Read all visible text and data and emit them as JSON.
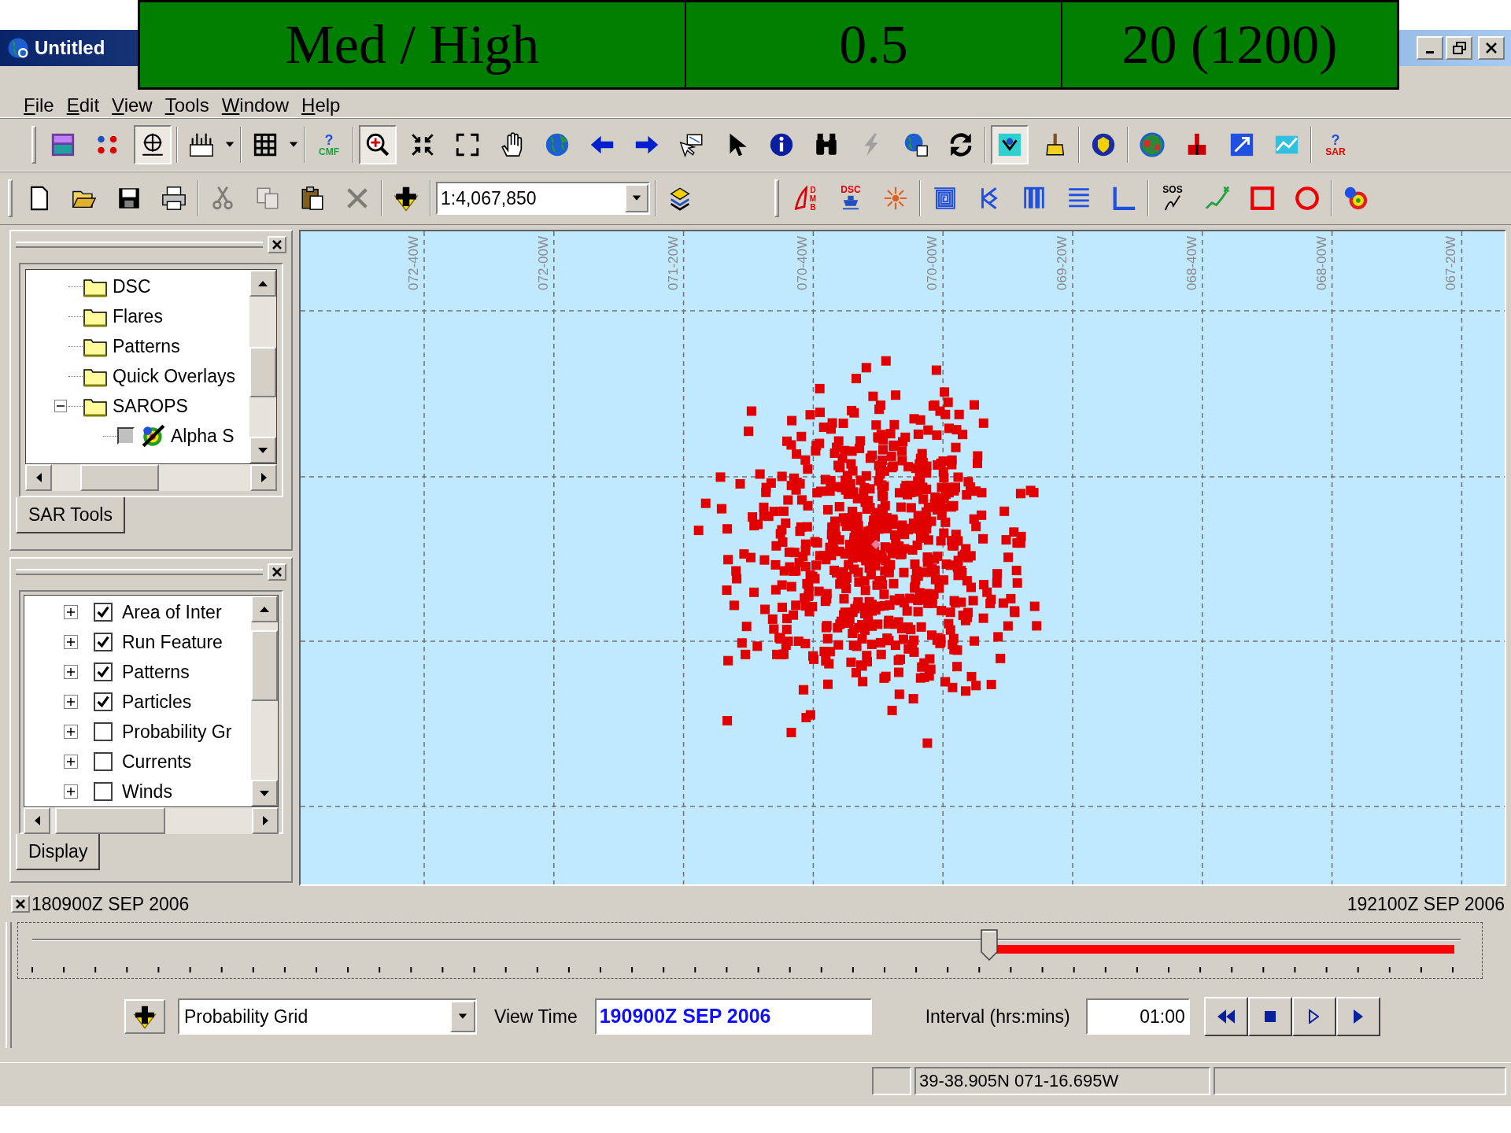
{
  "title_bar": {
    "title": "Untitled"
  },
  "banner": {
    "cells": [
      "Med / High",
      "0.5",
      "20 (1200)"
    ]
  },
  "menu": [
    "File",
    "Edit",
    "View",
    "Tools",
    "Window",
    "Help"
  ],
  "toolbar_1": [
    {
      "buttons": [
        {
          "kind": "logo",
          "selected": false
        },
        {
          "kind": "cluster",
          "selected": false
        },
        {
          "kind": "plate",
          "selected": true
        }
      ]
    },
    {
      "buttons": [
        {
          "kind": "ruler",
          "selected": false
        }
      ]
    },
    {
      "buttons": [
        {
          "kind": "grid",
          "selected": false
        }
      ]
    },
    {
      "buttons": [
        {
          "kind": "cmfhelp",
          "selected": false,
          "captions": [
            "?",
            "CMF"
          ]
        }
      ]
    },
    {
      "buttons": [
        {
          "kind": "zoom",
          "selected": true
        },
        {
          "kind": "collapse",
          "selected": false
        },
        {
          "kind": "expand",
          "selected": false
        },
        {
          "kind": "hand",
          "selected": false
        },
        {
          "kind": "globe",
          "selected": false
        },
        {
          "kind": "left",
          "selected": false
        },
        {
          "kind": "right",
          "selected": false
        },
        {
          "kind": "flag",
          "selected": false
        },
        {
          "kind": "pointer",
          "selected": false
        },
        {
          "kind": "info",
          "selected": false
        },
        {
          "kind": "binoculars",
          "selected": false
        },
        {
          "kind": "lightning",
          "selected": false
        },
        {
          "kind": "globelock",
          "selected": false
        },
        {
          "kind": "refresh",
          "selected": false
        }
      ]
    },
    {
      "buttons": [
        {
          "kind": "radar",
          "selected": true
        },
        {
          "kind": "brush",
          "selected": false
        }
      ]
    },
    {
      "buttons": [
        {
          "kind": "shield",
          "selected": false
        }
      ]
    },
    {
      "buttons": [
        {
          "kind": "earth",
          "selected": false
        },
        {
          "kind": "marker",
          "selected": false
        },
        {
          "kind": "bluebox",
          "selected": false
        },
        {
          "kind": "chart",
          "selected": false
        }
      ]
    },
    {
      "buttons": [
        {
          "kind": "sarhelp",
          "selected": false,
          "captions": [
            "?",
            "SAR"
          ]
        }
      ]
    }
  ],
  "toolbar_2": [
    {
      "buttons": [
        {
          "kind": "new",
          "disabled": false
        },
        {
          "kind": "open",
          "disabled": false
        },
        {
          "kind": "save",
          "disabled": false
        },
        {
          "kind": "print",
          "disabled": false
        }
      ]
    },
    {
      "buttons": [
        {
          "kind": "cut",
          "disabled": true
        },
        {
          "kind": "copy",
          "disabled": true
        },
        {
          "kind": "paste",
          "disabled": false
        },
        {
          "kind": "delete",
          "disabled": true
        }
      ]
    },
    {
      "buttons": [
        {
          "kind": "add",
          "disabled": false
        }
      ]
    },
    {
      "buttons": [
        {
          "kind": "combo",
          "disabled": false,
          "value": "1:4,067,850"
        }
      ]
    },
    {
      "buttons": [
        {
          "kind": "layers",
          "disabled": false
        }
      ]
    }
  ],
  "toolbar_3": [
    {
      "buttons": [
        {
          "kind": "dmb",
          "captions": [
            "DMB"
          ]
        },
        {
          "kind": "dsc",
          "captions": [
            "DSC"
          ]
        },
        {
          "kind": "flare"
        }
      ]
    },
    {
      "buttons": [
        {
          "kind": "spiral"
        },
        {
          "kind": "branch"
        },
        {
          "kind": "bars"
        },
        {
          "kind": "lines"
        },
        {
          "kind": "corner"
        }
      ]
    },
    {
      "buttons": [
        {
          "kind": "sos",
          "captions": [
            "SOS"
          ]
        },
        {
          "kind": "path"
        },
        {
          "kind": "square"
        },
        {
          "kind": "circle"
        }
      ]
    },
    {
      "buttons": [
        {
          "kind": "blob"
        }
      ]
    }
  ],
  "sar_tools_panel": {
    "tree": [
      {
        "label": "DSC",
        "kind": "folder"
      },
      {
        "label": "Flares",
        "kind": "folder"
      },
      {
        "label": "Patterns",
        "kind": "folder"
      },
      {
        "label": "Quick Overlays",
        "kind": "folder"
      },
      {
        "label": "SAROPS",
        "kind": "folder",
        "expanded": true,
        "children": [
          {
            "label": "Alpha S",
            "kind": "layer",
            "checked": false
          }
        ]
      }
    ],
    "tabs": [
      {
        "label": "SAR Tools",
        "selected": true
      }
    ]
  },
  "display_panel": {
    "layers": [
      {
        "label": "Area of Inter",
        "checked": true,
        "expanded": false
      },
      {
        "label": "Run Feature",
        "checked": true,
        "expanded": false
      },
      {
        "label": "Patterns",
        "checked": true,
        "expanded": false
      },
      {
        "label": "Particles",
        "checked": true,
        "expanded": false
      },
      {
        "label": "Probability Gr",
        "checked": false,
        "expanded": false
      },
      {
        "label": "Currents",
        "checked": false,
        "expanded": false
      },
      {
        "label": "Winds",
        "checked": false,
        "expanded": false
      }
    ],
    "tabs": [
      {
        "label": "Display",
        "selected": true
      }
    ]
  },
  "map": {
    "longitude_labels": [
      "072-40W",
      "072-00W",
      "071-20W",
      "070-40W",
      "070-00W",
      "069-20W",
      "068-40W",
      "068-00W",
      "067-20W"
    ]
  },
  "timeline": {
    "start": "180900Z SEP 2006",
    "end": "192100Z SEP 2006",
    "level": 0.67,
    "layer_select": "Probability Grid",
    "view_time_label": "View Time",
    "view_time": "190900Z SEP 2006",
    "interval_label": "Interval (hrs:mins)",
    "interval": "01:00"
  },
  "status_bar": {
    "coordinates": "39-38.905N 071-16.695W"
  }
}
